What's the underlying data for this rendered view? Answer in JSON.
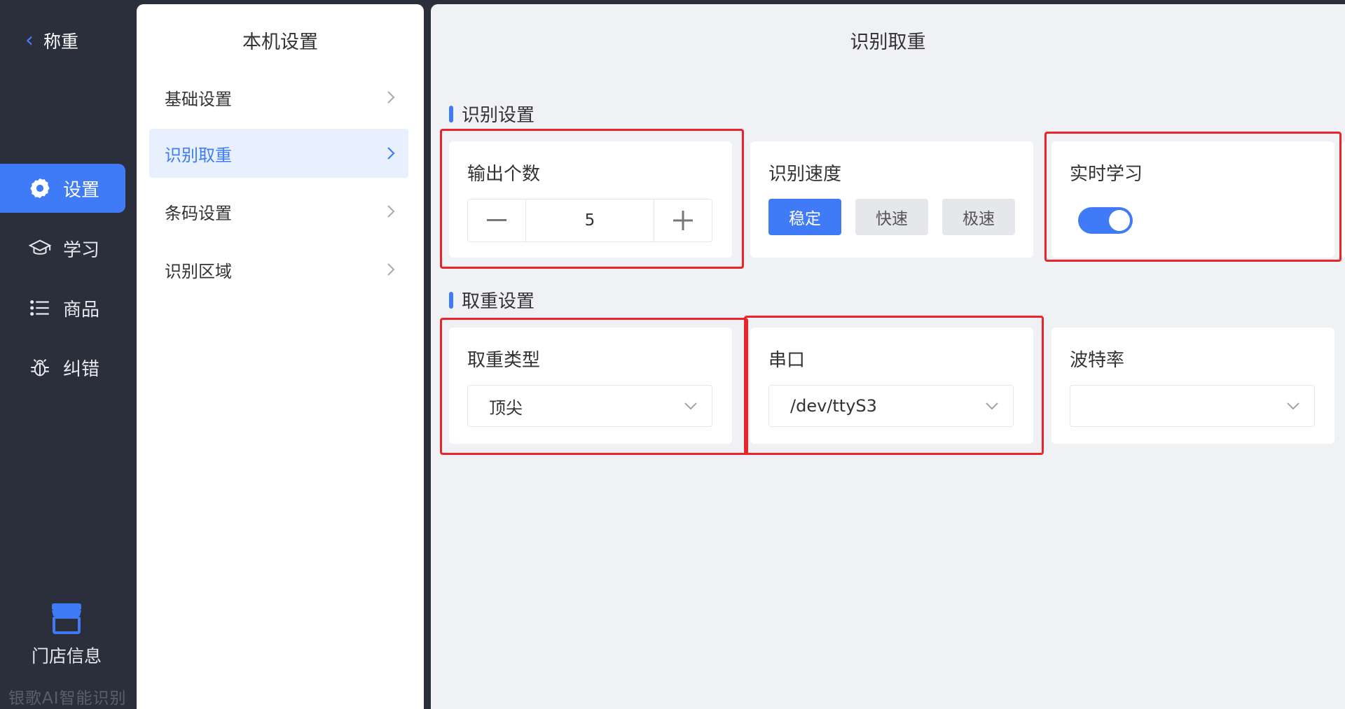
{
  "nav": {
    "back_label": "称重",
    "items": [
      {
        "label": "设置"
      },
      {
        "label": "学习"
      },
      {
        "label": "商品"
      },
      {
        "label": "纠错"
      }
    ],
    "store_label": "门店信息",
    "watermark": "银歌AI智能识别"
  },
  "menu": {
    "title": "本机设置",
    "items": [
      {
        "label": "基础设置"
      },
      {
        "label": "识别取重"
      },
      {
        "label": "条码设置"
      },
      {
        "label": "识别区域"
      }
    ]
  },
  "content": {
    "title": "识别取重",
    "recognition_section": {
      "label": "识别设置",
      "output_count": {
        "title": "输出个数",
        "value": "5"
      },
      "speed": {
        "title": "识别速度",
        "options": [
          "稳定",
          "快速",
          "极速"
        ],
        "selected": "稳定"
      },
      "realtime": {
        "title": "实时学习",
        "enabled": true
      }
    },
    "weight_section": {
      "label": "取重设置",
      "weight_type": {
        "title": "取重类型",
        "value": "顶尖"
      },
      "serial_port": {
        "title": "串口",
        "value": "/dev/ttyS3"
      },
      "baud_rate": {
        "title": "波特率",
        "value": ""
      }
    }
  },
  "colors": {
    "accent": "#3f7bf6",
    "nav_bg": "#2b2f3c",
    "highlight": "#e8262a"
  }
}
